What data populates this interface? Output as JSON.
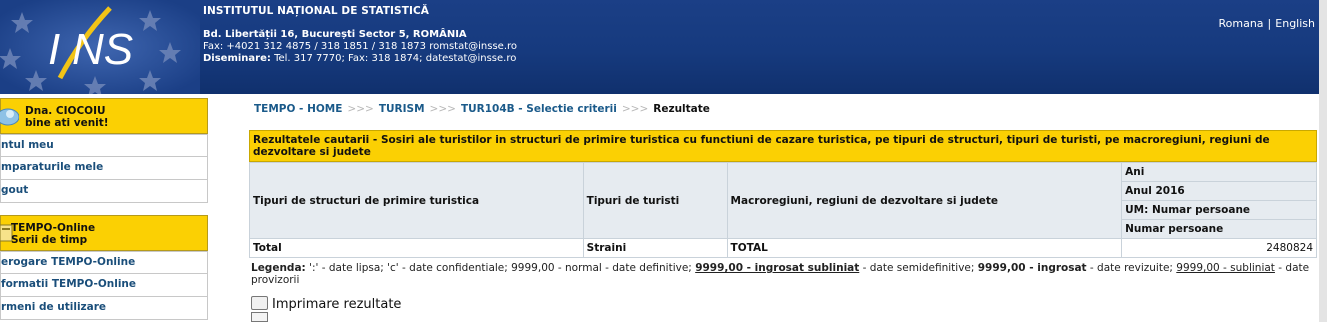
{
  "header": {
    "institution": "INSTITUTUL NAȚIONAL DE STATISTICĂ",
    "address": "Bd. Libertății 16, București Sector 5, ROMÂNIA",
    "fax": "Fax: +4021 312 4875 / 318 1851 / 318 1873 romstat@insse.ro",
    "dissemination_label": "Diseminare:",
    "dissemination": " Tel.  317 7770; Fax: 318 1874; datestat@insse.ro",
    "lang_ro": "Romana",
    "lang_sep": "|",
    "lang_en": "English",
    "logo_alt": "INS"
  },
  "sidebar": {
    "welcome_line1": "Dna. CIOCOIU",
    "welcome_line2": "bine ati venit!",
    "user_items": [
      "ntul meu",
      "mparaturile mele",
      "gout"
    ],
    "tempo_line1": "TEMPO-Online",
    "tempo_line2": "Serii de timp",
    "tempo_items": [
      "erogare TEMPO-Online",
      "formatii TEMPO-Online",
      "rmeni de utilizare"
    ]
  },
  "breadcrumb": {
    "home": "TEMPO - HOME",
    "sep": ">>>",
    "domain": "TURISM",
    "criteria": "TUR104B - Selectie criterii",
    "current": "Rezultate"
  },
  "result": {
    "title": "Rezultatele cautarii - Sosiri ale turistilor in structuri de primire turistica cu functiuni de cazare turistica, pe tipuri de structuri, tipuri de turisti, pe macroregiuni, regiuni de dezvoltare si judete",
    "col1": "Tipuri de structuri de primire turistica",
    "col2": "Tipuri de turisti",
    "col3": "Macroregiuni, regiuni de dezvoltare si judete",
    "right_h1": "Ani",
    "right_h2": "Anul 2016",
    "right_h3": "UM: Numar persoane",
    "right_h4": "Numar persoane",
    "row": {
      "structura": "Total",
      "turisti": "Straini",
      "regiune": "TOTAL",
      "valoare": "2480824"
    }
  },
  "legend": {
    "label": "Legenda:",
    "part1": " ':' - date lipsa; 'c' - date confidentiale; 9999,00 - normal - date definitive; ",
    "bold_ul": "9999,00 - ingrosat subliniat",
    "part2": " - date semidefinitive; ",
    "bold": "9999,00 - ingrosat",
    "part3": " - date revizuite; ",
    "ul": "9999,00 - subliniat",
    "part4": " - date provizorii"
  },
  "print": {
    "label": "Imprimare rezultate"
  },
  "colors": {
    "header_blue": "#163a7e",
    "accent_yellow": "#fbd003",
    "link_blue": "#1a5a8a",
    "table_header": "#e6ebf0"
  }
}
